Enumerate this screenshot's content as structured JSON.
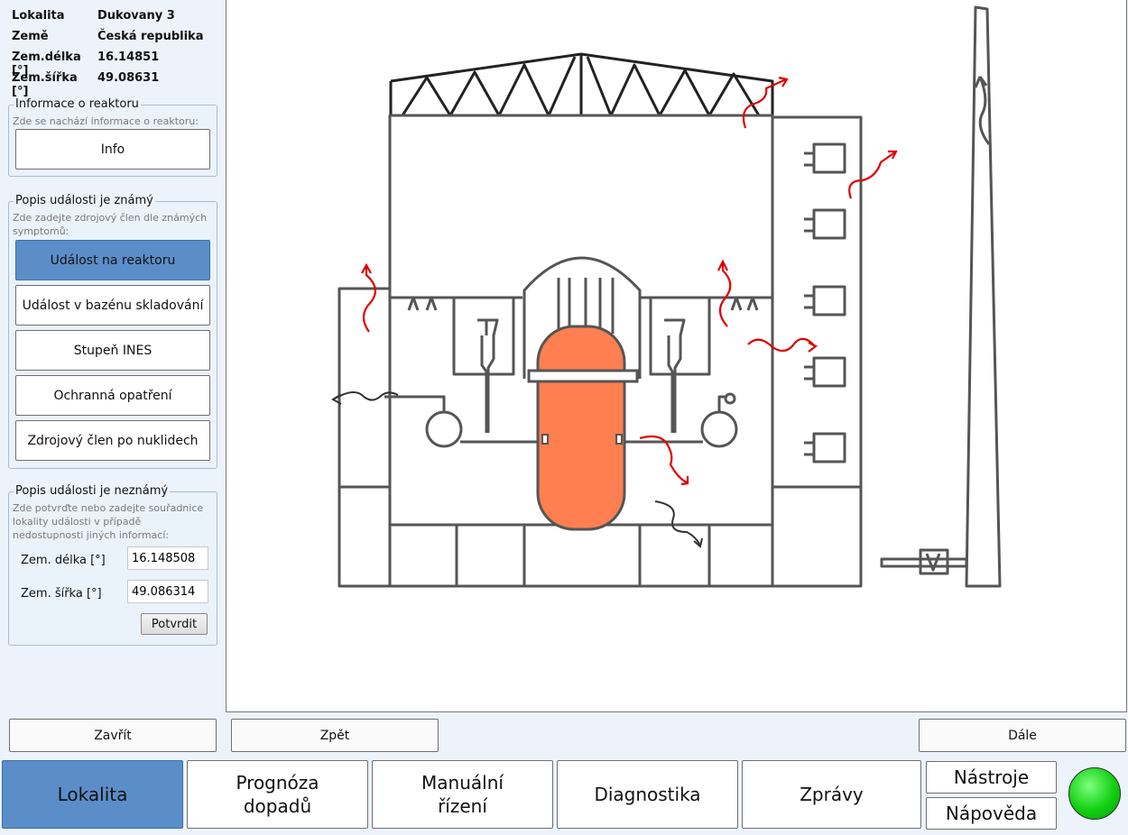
{
  "location": {
    "rows": [
      {
        "key": "Lokalita",
        "value": "Dukovany 3"
      },
      {
        "key": "Země",
        "value": "Česká republika"
      },
      {
        "key": "Zem.délka [°]",
        "value": "16.14851"
      },
      {
        "key": "Zem.šířka [°]",
        "value": "49.08631"
      }
    ]
  },
  "reactor_info": {
    "title": "Informace o reaktoru",
    "desc": "Zde se nachází informace o reaktoru:",
    "button": "Info"
  },
  "known_event": {
    "title": "Popis události je známý",
    "desc": "Zde zadejte zdrojový člen dle známých symptomů:",
    "buttons": [
      "Událost na reaktoru",
      "Událost v bazénu skladování",
      "Stupeň INES",
      "Ochranná opatření",
      "Zdrojový člen po nuklidech"
    ]
  },
  "unknown_event": {
    "title": "Popis události je neznámý",
    "desc": "Zde potvrďte nebo zadejte souřadnice lokality události v případě nedostupnosti jiných informací:",
    "lon_label": "Zem. délka [°]",
    "lon_value": "16.148508",
    "lat_label": "Zem. šířka [°]",
    "lat_value": "49.086314",
    "confirm": "Potvrdit"
  },
  "nav": {
    "close": "Zavřít",
    "back": "Zpět",
    "next": "Dále"
  },
  "tabs": {
    "lokalita": "Lokalita",
    "prognoza": "Prognóza dopadů",
    "manualni": "Manuální řízení",
    "diagnostika": "Diagnostika",
    "zpravy": "Zprávy",
    "nastroje": "Nástroje",
    "napoveda": "Nápověda"
  },
  "colors": {
    "accent": "#5b8ec9",
    "reactor_core": "#ff7f50",
    "release_arrow": "#e00000",
    "status_ok": "#12d012"
  }
}
